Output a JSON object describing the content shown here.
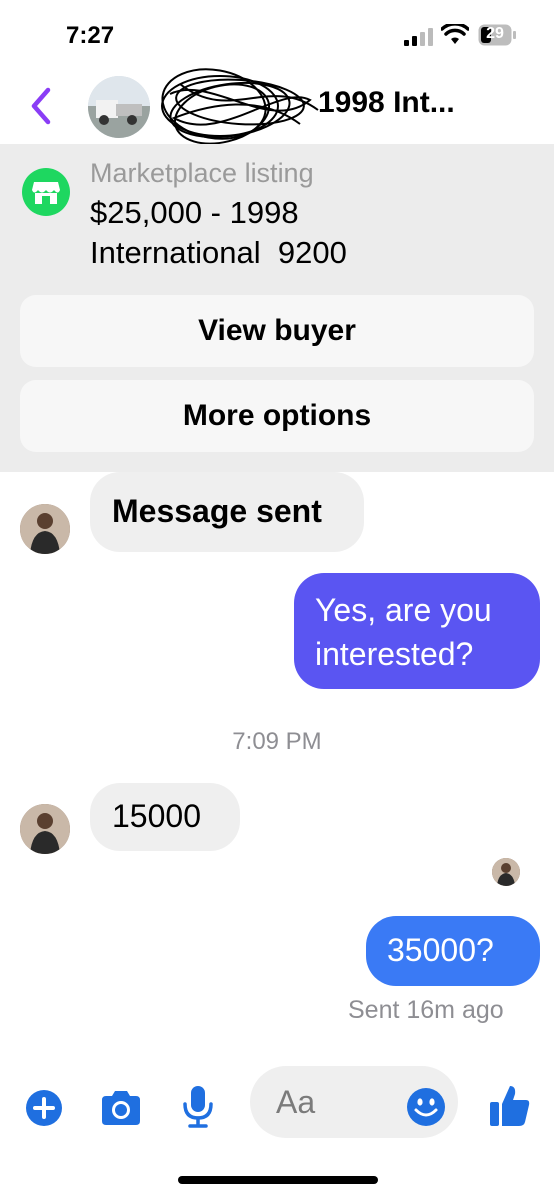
{
  "status_bar": {
    "time": "7:27",
    "battery": "29"
  },
  "header": {
    "title": "1998 Int..."
  },
  "listing": {
    "label": "Marketplace listing",
    "price_line1": "$25,000 - 1998",
    "price_line2": "International  9200",
    "view_buyer": "View buyer",
    "more_options": "More options"
  },
  "messages": {
    "system": "Message sent",
    "out1_line1": "Yes, are you",
    "out1_line2": "interested?",
    "timestamp": "7:09 PM",
    "in1": "15000",
    "out2": "35000?",
    "status": "Sent 16m ago"
  },
  "composer": {
    "placeholder": "Aa"
  },
  "colors": {
    "accent": "#8a3df6",
    "bubble_purple": "#5a55f2",
    "bubble_blue": "#3a7af5",
    "icon_blue": "#1f6fe0",
    "marketplace_green": "#1ed760"
  }
}
